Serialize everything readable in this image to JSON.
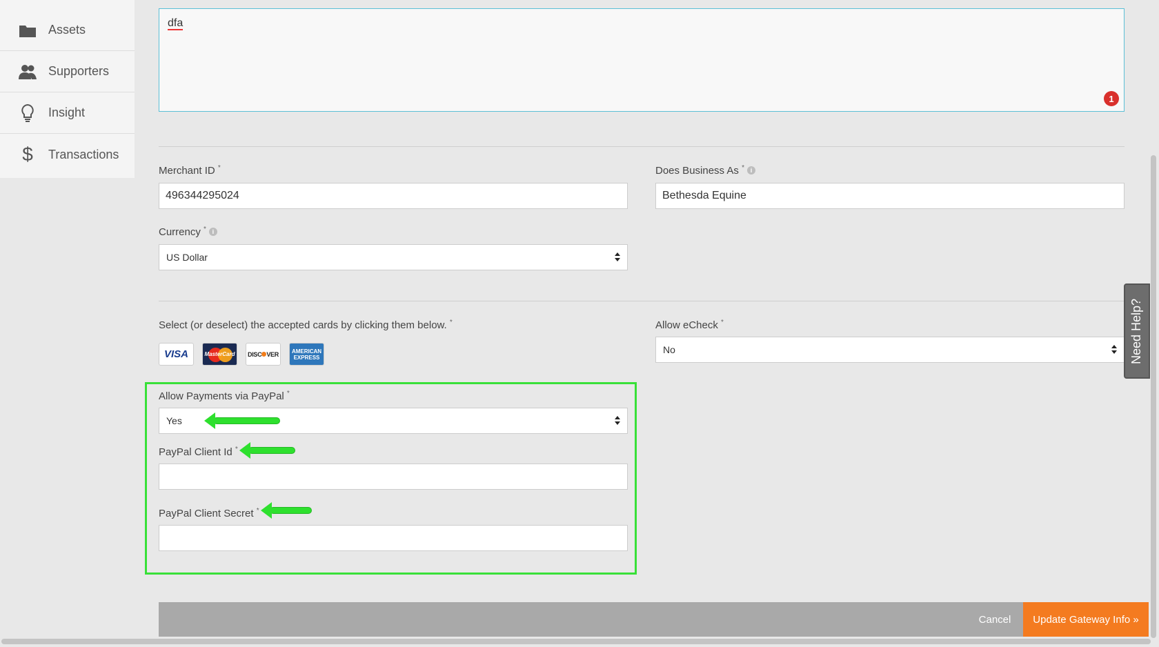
{
  "sidebar": {
    "items": [
      {
        "label": "Assets",
        "icon": "folder-icon"
      },
      {
        "label": "Supporters",
        "icon": "users-icon"
      },
      {
        "label": "Insight",
        "icon": "lightbulb-icon"
      },
      {
        "label": "Transactions",
        "icon": "dollar-icon"
      }
    ]
  },
  "description": {
    "value": "dfa",
    "error_count": "1"
  },
  "merchant": {
    "merchant_id_label": "Merchant ID",
    "merchant_id_value": "496344295024",
    "dba_label": "Does Business As",
    "dba_value": "Bethesda Equine",
    "currency_label": "Currency",
    "currency_value": "US Dollar",
    "required_mark": "*",
    "info_glyph": "i"
  },
  "cards": {
    "label": "Select (or deselect) the accepted cards by clicking them below.",
    "visa": "VISA",
    "mastercard": "MasterCard",
    "discover_a": "DISC",
    "discover_b": "VER",
    "amex_a": "AMERICAN",
    "amex_b": "EXPRESS"
  },
  "echeck": {
    "label": "Allow eCheck",
    "value": "No"
  },
  "paypal": {
    "allow_label": "Allow Payments via PayPal",
    "allow_value": "Yes",
    "client_id_label": "PayPal Client Id",
    "client_id_value": "",
    "client_secret_label": "PayPal Client Secret",
    "client_secret_value": "",
    "highlight_color": "#38e038"
  },
  "help": {
    "label": "Need Help?"
  },
  "footer": {
    "cancel_label": "Cancel",
    "update_label": "Update Gateway Info »",
    "accent": "#f47b20"
  }
}
